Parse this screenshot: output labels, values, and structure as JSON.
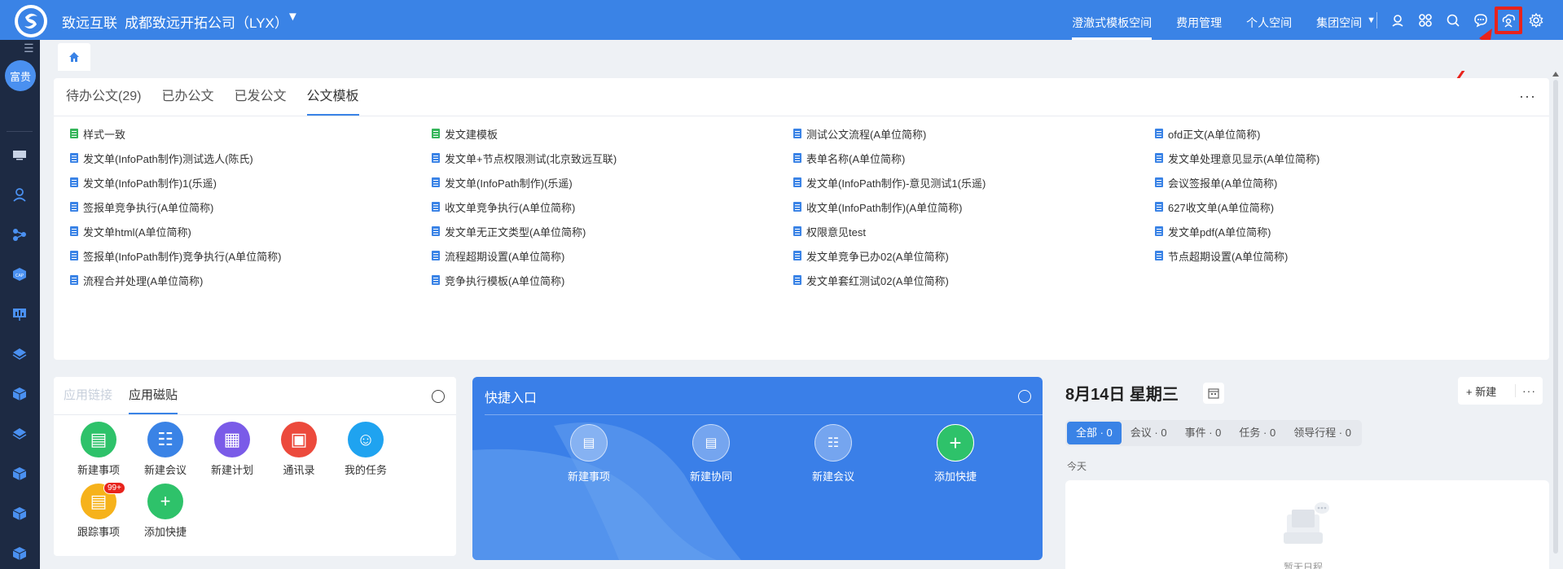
{
  "header": {
    "brand": "致远互联",
    "company": "成都致远开拓公司（LYX）",
    "nav": [
      {
        "label": "澄澈式模板空间",
        "active": true
      },
      {
        "label": "费用管理",
        "active": false
      },
      {
        "label": "个人空间",
        "active": false
      },
      {
        "label": "集团空间",
        "active": false
      }
    ],
    "icons": [
      "location-person-icon",
      "apps-icon",
      "search-icon",
      "chat-icon",
      "cloud-person-icon",
      "settings-icon"
    ]
  },
  "sidebar": {
    "avatar_text": "富贵",
    "icons": [
      "monitor-icon",
      "person-icon",
      "flow-icon",
      "cap-icon",
      "chart-board-icon",
      "layers-icon",
      "cube-icon",
      "layers-icon",
      "cube-icon",
      "cube-icon",
      "cube-icon"
    ]
  },
  "docs": {
    "tabs": [
      {
        "label": "待办公文(29)",
        "active": false
      },
      {
        "label": "已办公文",
        "active": false
      },
      {
        "label": "已发公文",
        "active": false
      },
      {
        "label": "公文模板",
        "active": true
      }
    ],
    "more": "···",
    "items": [
      {
        "label": "样式一致",
        "color": "#35b55a"
      },
      {
        "label": "发文建模板",
        "color": "#35b55a"
      },
      {
        "label": "测试公文流程(A单位简称)",
        "color": "#3a83e6"
      },
      {
        "label": "ofd正文(A单位简称)",
        "color": "#3a83e6"
      },
      {
        "label": "发文单(InfoPath制作)测试选人(陈氏)",
        "color": "#3a83e6"
      },
      {
        "label": "发文单+节点权限测试(北京致远互联)",
        "color": "#3a83e6"
      },
      {
        "label": "表单名称(A单位简称)",
        "color": "#3a83e6"
      },
      {
        "label": "发文单处理意见显示(A单位简称)",
        "color": "#3a83e6"
      },
      {
        "label": "发文单(InfoPath制作)1(乐遥)",
        "color": "#3a83e6"
      },
      {
        "label": "发文单(InfoPath制作)(乐遥)",
        "color": "#3a83e6"
      },
      {
        "label": "发文单(InfoPath制作)-意见测试1(乐遥)",
        "color": "#3a83e6"
      },
      {
        "label": "会议签报单(A单位简称)",
        "color": "#3a83e6"
      },
      {
        "label": "签报单竞争执行(A单位简称)",
        "color": "#3a83e6"
      },
      {
        "label": "收文单竞争执行(A单位简称)",
        "color": "#3a83e6"
      },
      {
        "label": "收文单(InfoPath制作)(A单位简称)",
        "color": "#3a83e6"
      },
      {
        "label": "627收文单(A单位简称)",
        "color": "#3a83e6"
      },
      {
        "label": "发文单html(A单位简称)",
        "color": "#3a83e6"
      },
      {
        "label": "发文单无正文类型(A单位简称)",
        "color": "#3a83e6"
      },
      {
        "label": "权限意见test",
        "color": "#3a83e6"
      },
      {
        "label": "发文单pdf(A单位简称)",
        "color": "#3a83e6"
      },
      {
        "label": "签报单(InfoPath制作)竞争执行(A单位简称)",
        "color": "#3a83e6"
      },
      {
        "label": "流程超期设置(A单位简称)",
        "color": "#3a83e6"
      },
      {
        "label": "发文单竞争已办02(A单位简称)",
        "color": "#3a83e6"
      },
      {
        "label": "节点超期设置(A单位简称)",
        "color": "#3a83e6"
      },
      {
        "label": "流程合并处理(A单位简称)",
        "color": "#3a83e6"
      },
      {
        "label": "竞争执行模板(A单位简称)",
        "color": "#3a83e6"
      },
      {
        "label": "发文单套红测试02(A单位简称)",
        "color": "#3a83e6"
      }
    ]
  },
  "apps": {
    "tabs": [
      {
        "label": "应用链接",
        "active": false
      },
      {
        "label": "应用磁贴",
        "active": true
      }
    ],
    "items": [
      {
        "label": "新建事项",
        "color": "#2ec26a",
        "icon": "new-task-icon",
        "glyph": "▤"
      },
      {
        "label": "新建会议",
        "color": "#3a83e6",
        "icon": "meeting-icon",
        "glyph": "☷"
      },
      {
        "label": "新建计划",
        "color": "#7a5be8",
        "icon": "plan-icon",
        "glyph": "▦"
      },
      {
        "label": "通讯录",
        "color": "#ec4a3c",
        "icon": "contacts-icon",
        "glyph": "▣"
      },
      {
        "label": "我的任务",
        "color": "#1fa3f0",
        "icon": "my-task-icon",
        "glyph": "☺"
      },
      {
        "label": "跟踪事项",
        "color": "#f6b21b",
        "icon": "track-icon",
        "glyph": "▤",
        "badge": "99+"
      },
      {
        "label": "添加快捷",
        "color": "#2ec26a",
        "icon": "add-icon",
        "glyph": "+"
      }
    ]
  },
  "quick": {
    "title": "快捷入口",
    "items": [
      {
        "label": "新建事项",
        "icon": "new-task-icon",
        "glyph": "▤"
      },
      {
        "label": "新建协同",
        "icon": "collab-icon",
        "glyph": "▤"
      },
      {
        "label": "新建会议",
        "icon": "meeting-icon",
        "glyph": "☷"
      },
      {
        "label": "添加快捷",
        "icon": "add-icon",
        "glyph": "+"
      }
    ]
  },
  "calendar": {
    "date": "8月14日 星期三",
    "new_label": "+ 新建",
    "more": "···",
    "filters": [
      {
        "label": "全部 · 0",
        "active": true
      },
      {
        "label": "会议 · 0",
        "active": false
      },
      {
        "label": "事件 · 0",
        "active": false
      },
      {
        "label": "任务 · 0",
        "active": false
      },
      {
        "label": "领导行程 · 0",
        "active": false
      }
    ],
    "today_label": "今天",
    "empty_text": "暂无日程"
  }
}
